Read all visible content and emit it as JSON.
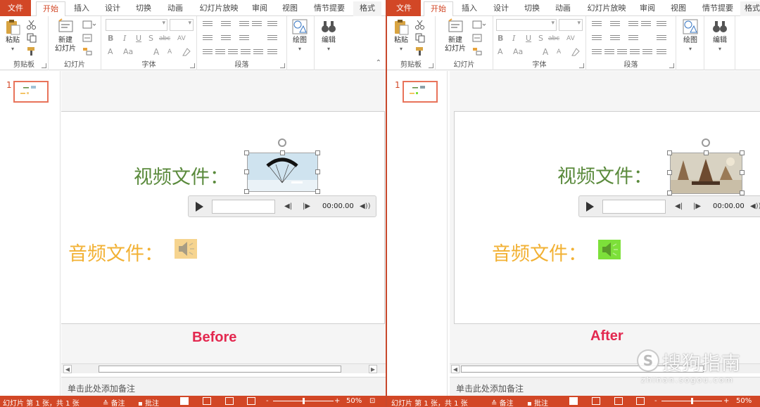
{
  "tabs": [
    "文件",
    "开始",
    "插入",
    "设计",
    "切换",
    "动画",
    "幻灯片放映",
    "审阅",
    "视图",
    "情节提要",
    "格式"
  ],
  "ribbon": {
    "clipboard": {
      "label": "剪贴板",
      "paste": "粘贴"
    },
    "slides": {
      "label": "幻灯片",
      "new_slide_line1": "新建",
      "new_slide_line2": "幻灯片"
    },
    "font": {
      "label": "字体",
      "bold": "B",
      "italic": "I",
      "underline": "U",
      "shadow": "S",
      "strike": "abc",
      "spacing": "AV",
      "font_color": "A",
      "case": "Aa",
      "grow": "A",
      "shrink": "A"
    },
    "paragraph": {
      "label": "段落"
    },
    "drawing": {
      "label": "绘图"
    },
    "editing": {
      "label": "编辑"
    }
  },
  "thumbnail_number": "1",
  "slide": {
    "video_label": "视频文件：",
    "audio_label": "音频文件：",
    "player_time": "00:00.00"
  },
  "captions": {
    "before": "Before",
    "after": "After"
  },
  "notes_placeholder": "单击此处添加备注",
  "status": {
    "slide_info": "幻灯片 第 1 张，共 1 张",
    "notes": "备注",
    "comments": "批注",
    "zoom": "50%",
    "zoom_minus": "-",
    "zoom_plus": "+"
  },
  "watermark": {
    "brand": "搜狗指南",
    "logo_letter": "S",
    "url": "zhinan.sogou.com"
  },
  "colors": {
    "accent": "#d24726",
    "video_label": "#5a8a3c",
    "audio_label": "#f2b134",
    "caption": "#e3284f"
  }
}
